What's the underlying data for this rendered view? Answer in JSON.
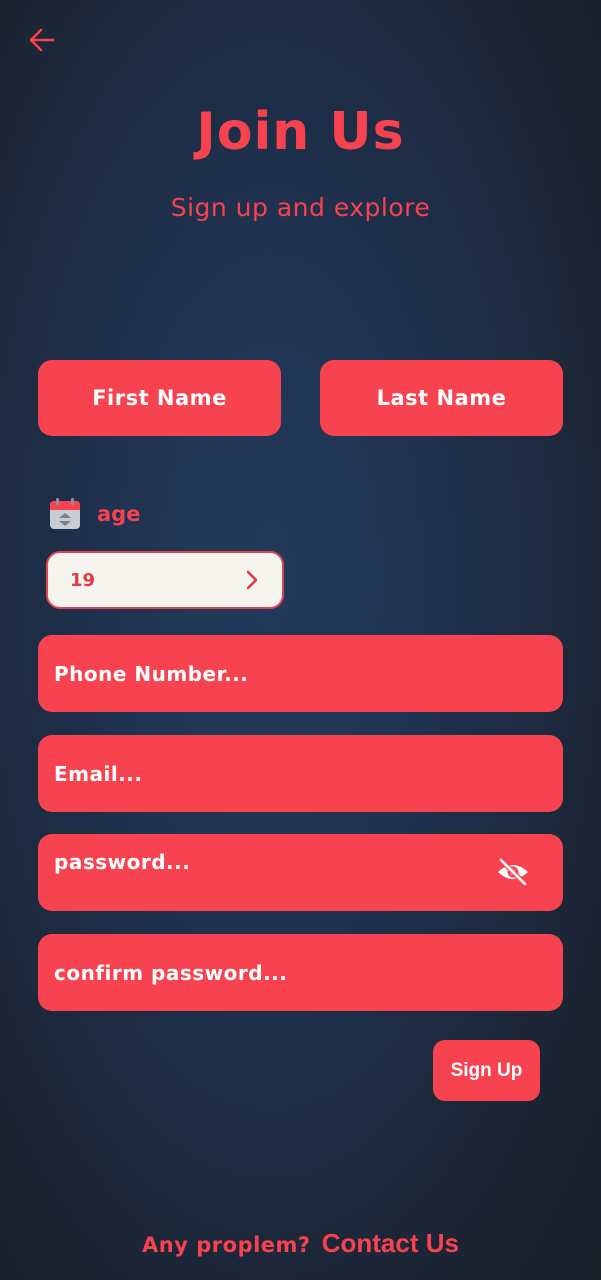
{
  "header": {
    "back_icon": "arrow-left-icon",
    "title": "Join Us",
    "subtitle": "Sign up and explore"
  },
  "names": {
    "first": "First Name",
    "last": "Last Name"
  },
  "age": {
    "icon": "calendar-icon",
    "label": "age",
    "value": "19",
    "chevron_icon": "chevron-right-icon"
  },
  "fields": {
    "phone": "Phone Number...",
    "email": "Email...",
    "password": "password...",
    "password_toggle_icon": "eye-off-icon",
    "confirm": "confirm password..."
  },
  "actions": {
    "signup": "Sign Up"
  },
  "footer": {
    "question": "Any proplem?",
    "link": "Contact Us"
  },
  "colors": {
    "accent": "#f7434f",
    "background": "#1f3250",
    "select_bg": "#f6f4ef",
    "text_on_accent": "#ffffff"
  }
}
